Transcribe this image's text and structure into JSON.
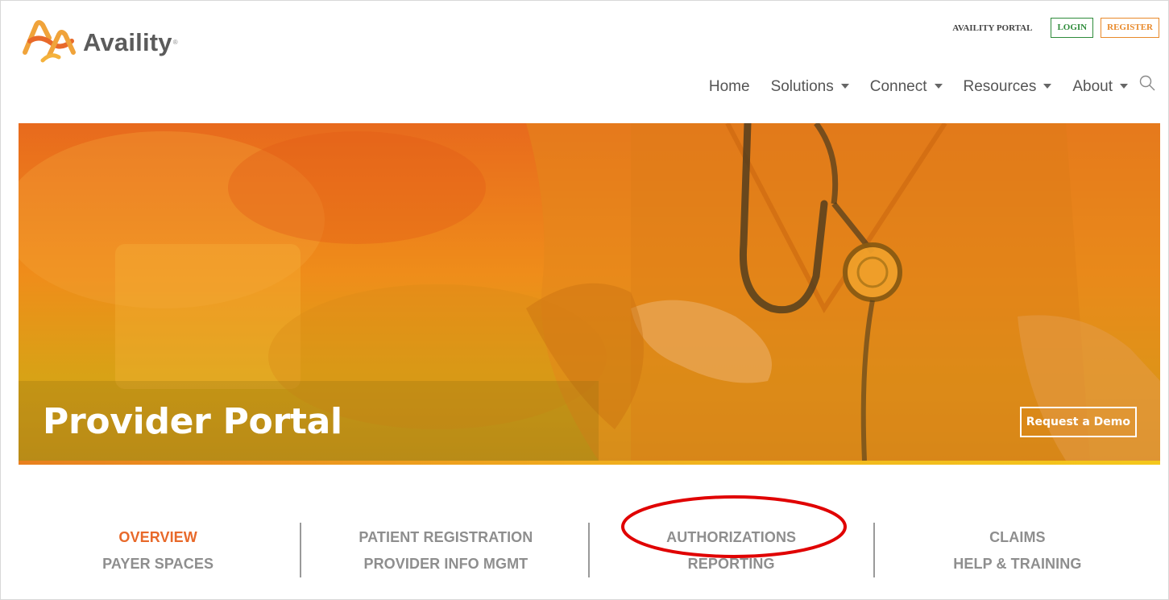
{
  "brand": {
    "name": "Availity",
    "reg_mark": "®",
    "logo_colors": [
      "#f0a33a",
      "#e8692a"
    ]
  },
  "utility_nav": {
    "portal_link": "AVAILITY PORTAL",
    "login": "LOGIN",
    "register": "REGISTER"
  },
  "main_nav": {
    "items": [
      {
        "label": "Home",
        "has_dropdown": false
      },
      {
        "label": "Solutions",
        "has_dropdown": true
      },
      {
        "label": "Connect",
        "has_dropdown": true
      },
      {
        "label": "Resources",
        "has_dropdown": true
      },
      {
        "label": "About",
        "has_dropdown": true
      }
    ],
    "search_icon": "search-icon"
  },
  "hero": {
    "title": "Provider Portal",
    "cta": "Request a Demo",
    "gradient_colors": [
      "#e86a1d",
      "#ef8d1a",
      "#d8a216"
    ]
  },
  "section_tabs": {
    "row1": [
      "OVERVIEW",
      "PATIENT REGISTRATION",
      "AUTHORIZATIONS",
      "CLAIMS"
    ],
    "row2": [
      "PAYER SPACES",
      "PROVIDER INFO MGMT",
      "REPORTING",
      "HELP & TRAINING"
    ],
    "active": "OVERVIEW",
    "active_color": "#e8692a",
    "inactive_color": "#8e8e8e"
  },
  "annotation": {
    "highlighted_tab": "AUTHORIZATIONS",
    "color": "#e00000"
  }
}
